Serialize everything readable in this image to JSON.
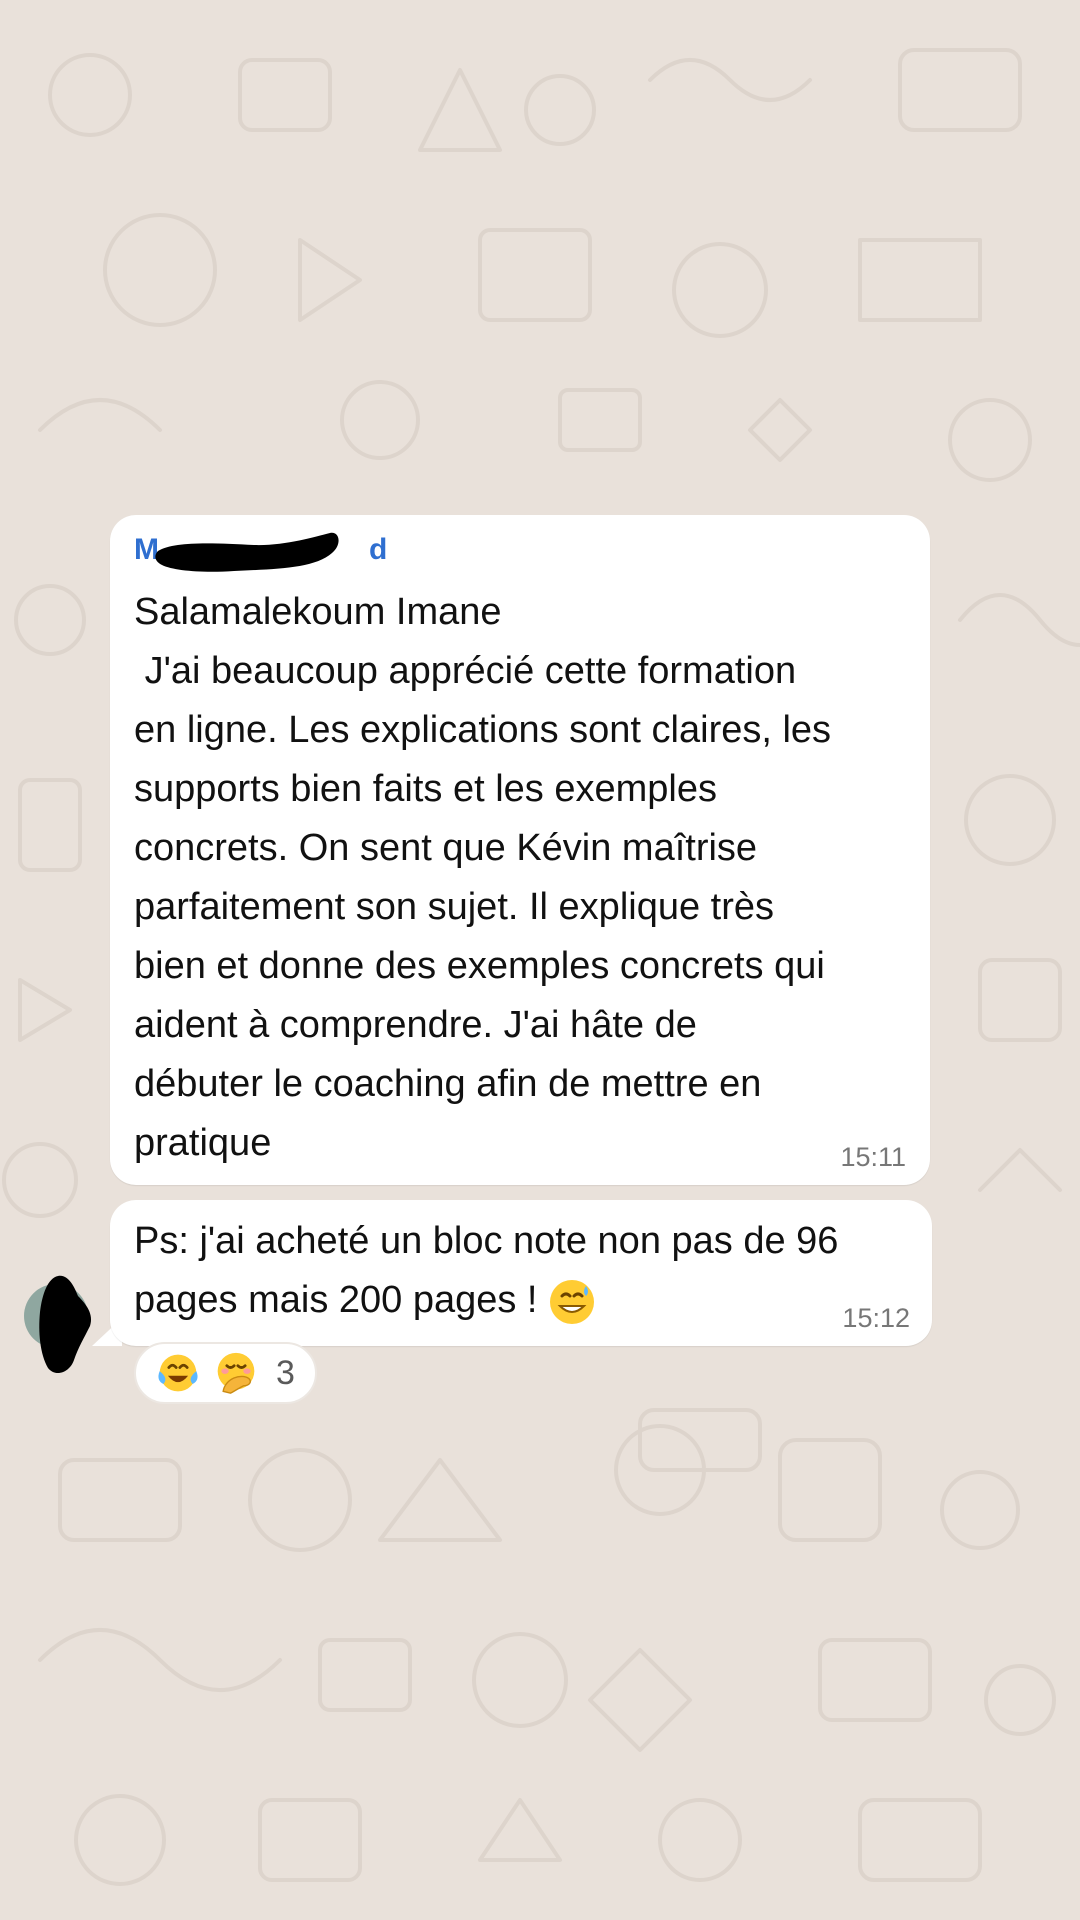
{
  "wallpaper": {
    "background_color": "#e9e1da",
    "doodle_color": "#ddd4cc"
  },
  "messages": [
    {
      "sender_name": "M",
      "sender_name_end": "d",
      "sender_color": "#2f6fd0",
      "text": "Salamalekoum Imane\n J'ai beaucoup apprécié cette formation\nen ligne. Les explications sont claires, les\nsupports bien faits et les exemples\nconcrets. On sent que Kévin maîtrise\nparfaitement son sujet. Il explique très\nbien et donne des exemples concrets qui\naident à comprendre. J'ai hâte de\ndébuter le coaching afin de mettre en\npratique",
      "time": "15:11"
    },
    {
      "text": "Ps: j'ai acheté un bloc note non pas de 96\npages mais 200 pages ! ",
      "emoji": "grinning-sweat-face",
      "time": "15:12",
      "reactions": {
        "emojis": [
          "tears-of-joy-face",
          "face-with-hand-over-mouth"
        ],
        "count": "3"
      }
    }
  ]
}
